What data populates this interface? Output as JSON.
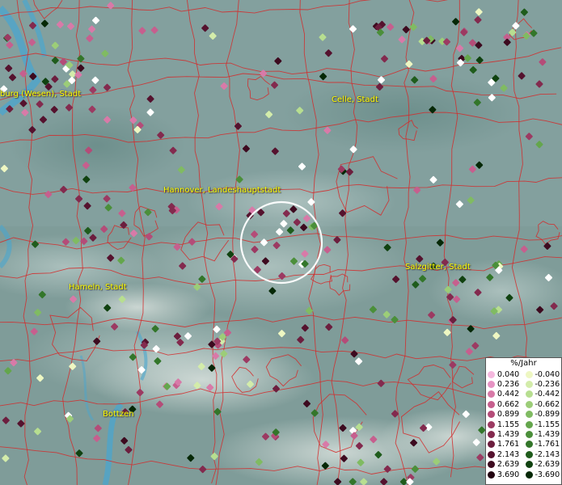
{
  "map": {
    "cities": [
      {
        "label": "burg (Wesen), Stadt"
      },
      {
        "label": "Celle, Stadt"
      },
      {
        "label": "Hannover, Landeshauptstadt"
      },
      {
        "label": "Salzgitter, Stadt"
      },
      {
        "label": "Hameln, Stadt"
      },
      {
        "label": "Bottzen"
      }
    ]
  },
  "legend": {
    "title": "%/Jahr",
    "positive": [
      {
        "value": "0.040",
        "color": "#f4b8de"
      },
      {
        "value": "0.236",
        "color": "#e693c3"
      },
      {
        "value": "0.442",
        "color": "#d87aa8"
      },
      {
        "value": "0.662",
        "color": "#c65f8e"
      },
      {
        "value": "0.899",
        "color": "#b44c78"
      },
      {
        "value": "1.155",
        "color": "#9c3a62"
      },
      {
        "value": "1.439",
        "color": "#832a4e"
      },
      {
        "value": "1.761",
        "color": "#6c1e3e"
      },
      {
        "value": "2.143",
        "color": "#55122e"
      },
      {
        "value": "2.639",
        "color": "#3d0a1f"
      },
      {
        "value": "3.690",
        "color": "#220310"
      }
    ],
    "negative": [
      {
        "value": "-0.040",
        "color": "#eef7c2"
      },
      {
        "value": "-0.236",
        "color": "#d3ecaa"
      },
      {
        "value": "-0.442",
        "color": "#b7de90"
      },
      {
        "value": "-0.662",
        "color": "#9ccd78"
      },
      {
        "value": "-0.899",
        "color": "#80bb62"
      },
      {
        "value": "-1.155",
        "color": "#64a64c"
      },
      {
        "value": "-1.439",
        "color": "#4b8f3a"
      },
      {
        "value": "-1.761",
        "color": "#33762a"
      },
      {
        "value": "-2.143",
        "color": "#1f5c1c"
      },
      {
        "value": "-2.639",
        "color": "#104210"
      },
      {
        "value": "-3.690",
        "color": "#052806"
      }
    ]
  }
}
